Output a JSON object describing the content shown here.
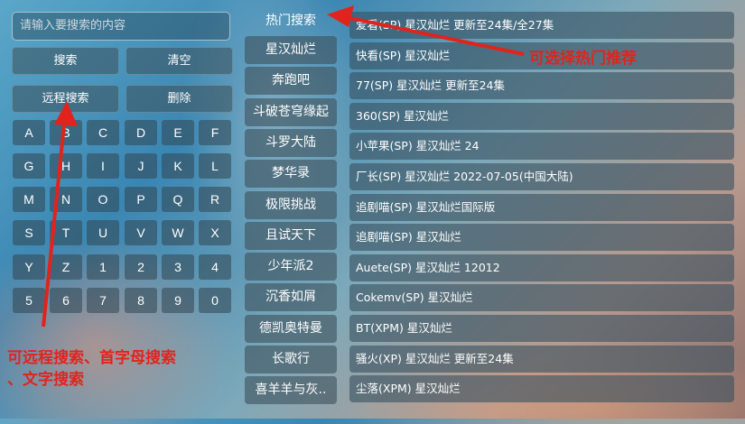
{
  "search": {
    "placeholder": "请输入要搜索的内容"
  },
  "buttons": {
    "search": "搜索",
    "clear": "清空",
    "remote": "远程搜索",
    "delete": "删除"
  },
  "keyboard": [
    [
      "A",
      "B",
      "C",
      "D",
      "E",
      "F"
    ],
    [
      "G",
      "H",
      "I",
      "J",
      "K",
      "L"
    ],
    [
      "M",
      "N",
      "O",
      "P",
      "Q",
      "R"
    ],
    [
      "S",
      "T",
      "U",
      "V",
      "W",
      "X"
    ],
    [
      "Y",
      "Z",
      "1",
      "2",
      "3",
      "4"
    ],
    [
      "5",
      "6",
      "7",
      "8",
      "9",
      "0"
    ]
  ],
  "hot": {
    "title": "热门搜索",
    "items": [
      "星汉灿烂",
      "奔跑吧",
      "斗破苍穹缘起",
      "斗罗大陆",
      "梦华录",
      "极限挑战",
      "且试天下",
      "少年派2",
      "沉香如屑",
      "德凯奥特曼",
      "长歌行",
      "喜羊羊与灰.."
    ]
  },
  "results": [
    "爱看(SP)  星汉灿烂  更新至24集/全27集",
    "快看(SP)  星汉灿烂",
    "77(SP)  星汉灿烂  更新至24集",
    "360(SP)  星汉灿烂",
    "小苹果(SP)  星汉灿烂  24",
    "厂长(SP)  星汉灿烂  2022-07-05(中国大陆)",
    "追剧喵(SP)  星汉灿烂国际版",
    "追剧喵(SP)  星汉灿烂",
    "Auete(SP)  星汉灿烂  12012",
    "Cokemv(SP)  星汉灿烂",
    "BT(XPM)  星汉灿烂",
    "骚火(XP)  星汉灿烂  更新至24集",
    "尘落(XPM)  星汉灿烂"
  ],
  "annotations": {
    "hot_tip": "可选择热门推荐",
    "search_tip_line1": "可远程搜索、首字母搜索",
    "search_tip_line2": "、文字搜索",
    "color": "#e0241d"
  }
}
